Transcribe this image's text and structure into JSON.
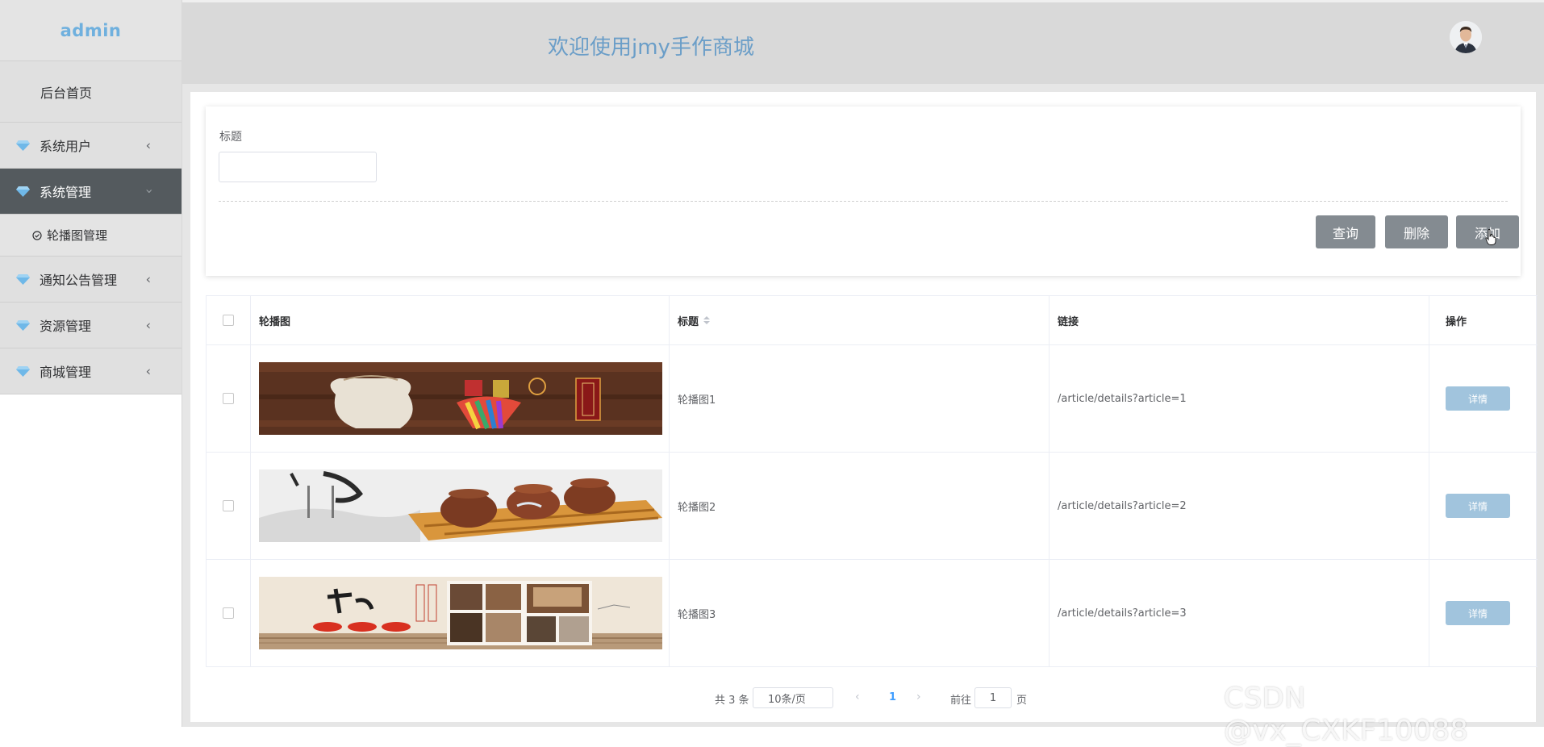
{
  "sidebar": {
    "brand": "admin",
    "home": "后台首页",
    "groups": [
      {
        "label": "系统用户",
        "icon": "gem-icon"
      },
      {
        "label": "系统管理",
        "icon": "gem-icon",
        "active": true
      },
      {
        "label": "通知公告管理",
        "icon": "gem-icon"
      },
      {
        "label": "资源管理",
        "icon": "gem-icon"
      },
      {
        "label": "商城管理",
        "icon": "gem-icon"
      }
    ],
    "submenu": {
      "label": "轮播图管理",
      "icon": "circle-check-icon"
    }
  },
  "header": {
    "welcome": "欢迎使用jmy手作商城",
    "avatar_icon": "user-avatar"
  },
  "search": {
    "title_label": "标题",
    "title_value": "",
    "query_label": "查询",
    "delete_label": "删除",
    "add_label": "添加"
  },
  "table": {
    "columns": {
      "image": "轮播图",
      "title": "标题",
      "link": "链接",
      "op": "操作"
    },
    "rows": [
      {
        "title": "轮播图1",
        "link": "/article/details?article=1",
        "action": "详情"
      },
      {
        "title": "轮播图2",
        "link": "/article/details?article=2",
        "action": "详情"
      },
      {
        "title": "轮播图3",
        "link": "/article/details?article=3",
        "action": "详情"
      }
    ]
  },
  "pagination": {
    "total": "共 3 条",
    "page_size": "10条/页",
    "current": "1",
    "goto_label": "前往",
    "goto_value": "1",
    "page_suffix": "页"
  },
  "watermark": "CSDN @vx_CXKF10088",
  "colors": {
    "brand": "#6fb0de",
    "active_menu": "#545a5e",
    "header_bg": "#d9d9d9",
    "button_gray": "#848b91",
    "detail_button": "#a1c4dd",
    "welcome_text": "#6b9ec8"
  }
}
